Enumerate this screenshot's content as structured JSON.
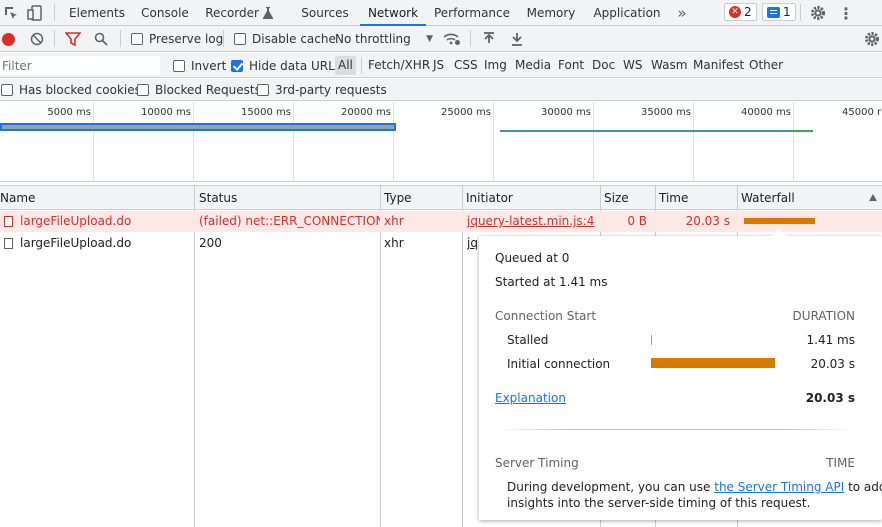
{
  "tabs": [
    {
      "label": "Elements"
    },
    {
      "label": "Console"
    },
    {
      "label": "Recorder"
    },
    {
      "label": "Sources"
    },
    {
      "label": "Network"
    },
    {
      "label": "Performance"
    },
    {
      "label": "Memory"
    },
    {
      "label": "Application"
    }
  ],
  "badges": {
    "errors": "2",
    "messages": "1"
  },
  "toolbar": {
    "preserve_log": "Preserve log",
    "disable_cache": "Disable cache",
    "throttling": "No throttling"
  },
  "filter": {
    "placeholder": "Filter",
    "invert": "Invert",
    "hide_data_urls": "Hide data URLs",
    "types": [
      "All",
      "Fetch/XHR",
      "JS",
      "CSS",
      "Img",
      "Media",
      "Font",
      "Doc",
      "WS",
      "Wasm",
      "Manifest",
      "Other"
    ]
  },
  "blocked": {
    "cookies": "Has blocked cookies",
    "requests": "Blocked Requests",
    "third_party": "3rd-party requests"
  },
  "overview": {
    "ticks": [
      "5000 ms",
      "10000 ms",
      "15000 ms",
      "20000 ms",
      "25000 ms",
      "30000 ms",
      "35000 ms",
      "40000 ms",
      "45000 r"
    ]
  },
  "columns": {
    "name": "Name",
    "status": "Status",
    "type": "Type",
    "initiator": "Initiator",
    "size": "Size",
    "time": "Time",
    "waterfall": "Waterfall"
  },
  "rows": [
    {
      "name": "largeFileUpload.do",
      "status": "(failed) net::ERR_CONNECTION...",
      "type": "xhr",
      "initiator": "jquery-latest.min.js:4",
      "size": "0 B",
      "time": "20.03 s"
    },
    {
      "name": "largeFileUpload.do",
      "status": "200",
      "type": "xhr",
      "initiator": "jq",
      "size": "",
      "time": ""
    }
  ],
  "popover": {
    "queued": "Queued at 0",
    "started": "Started at 1.41 ms",
    "connection_start": "Connection Start",
    "duration": "DURATION",
    "stalled_label": "Stalled",
    "stalled_value": "1.41 ms",
    "initial_label": "Initial connection",
    "initial_value": "20.03 s",
    "explanation": "Explanation",
    "total": "20.03 s",
    "server_timing": "Server Timing",
    "time": "TIME",
    "dev_text_1": "During development, you can use ",
    "dev_link": "the Server Timing API",
    "dev_text_2": " to add",
    "dev_text_3": "insights into the server-side timing of this request."
  },
  "colors": {
    "accent": "#1a73e8",
    "error": "#d93025",
    "waterfall_bar": "#d97a00",
    "failed_row_bg": "#fce8e6"
  }
}
